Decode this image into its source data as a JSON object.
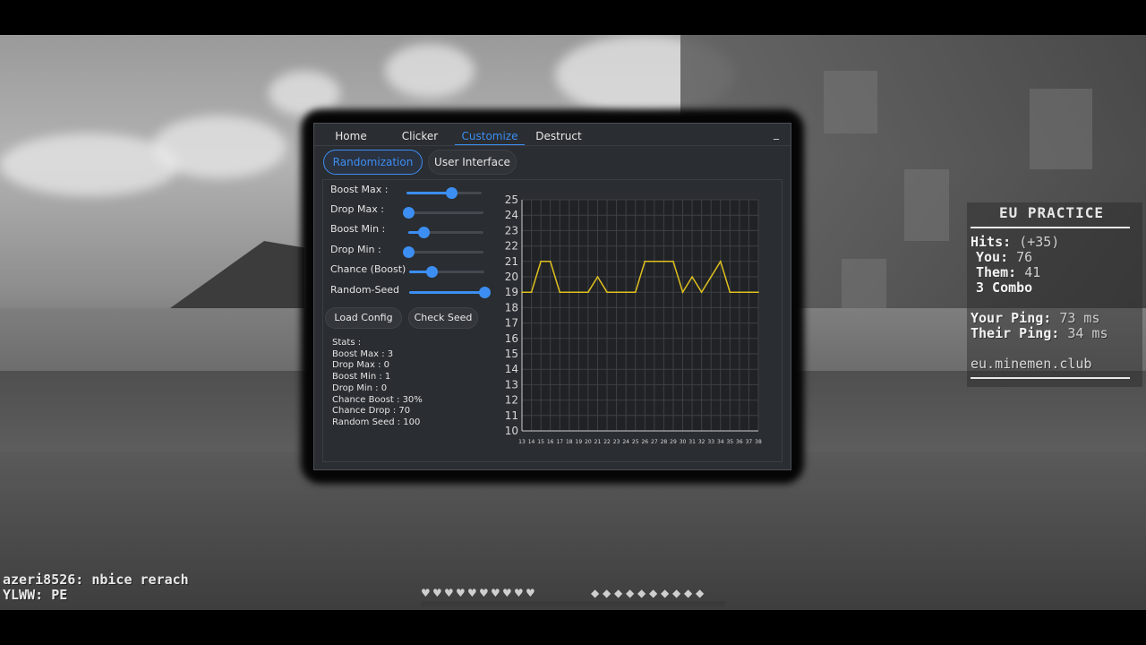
{
  "app": {
    "tabs": [
      "Home",
      "Clicker",
      "Customize",
      "Destruct"
    ],
    "active_tab": "Customize",
    "minimize": "_",
    "subtabs": [
      "Randomization",
      "User Interface"
    ],
    "active_subtab": "Randomization",
    "accent": "#3c8ef2",
    "sliders": [
      {
        "label": "Boost Max :",
        "value_fraction": 0.59
      },
      {
        "label": "Drop Max :",
        "value_fraction": 0.0
      },
      {
        "label": "Boost Min :",
        "value_fraction": 0.2
      },
      {
        "label": "Drop Min :",
        "value_fraction": 0.0
      },
      {
        "label": "Chance (Boost)",
        "value_fraction": 0.3
      },
      {
        "label": "Random-Seed",
        "value_fraction": 1.0
      }
    ],
    "buttons": {
      "load_config": "Load Config",
      "check_seed": "Check Seed"
    },
    "stats": {
      "header": "Stats :",
      "lines": [
        "Boost Max : 3",
        "Drop Max : 0",
        "Boost Min : 1",
        "Drop Min : 0",
        "Chance Boost : 30%",
        "Chance Drop : 70",
        "Random Seed : 100"
      ]
    }
  },
  "chart_data": {
    "type": "line",
    "x": [
      13,
      14,
      15,
      16,
      17,
      18,
      19,
      20,
      21,
      22,
      23,
      24,
      25,
      26,
      27,
      28,
      29,
      30,
      31,
      32,
      33,
      34,
      35,
      36,
      37,
      38
    ],
    "series": [
      {
        "values": [
          19,
          19,
          21,
          21,
          19,
          19,
          19,
          19,
          20,
          19,
          19,
          19,
          19,
          21,
          21,
          21,
          21,
          19,
          20,
          19,
          20,
          21,
          19,
          19,
          19,
          19
        ],
        "color": "#e0c020"
      }
    ],
    "ylim": [
      10,
      25
    ],
    "yticks": [
      10,
      11,
      12,
      13,
      14,
      15,
      16,
      17,
      18,
      19,
      20,
      21,
      22,
      23,
      24,
      25
    ],
    "grid": true
  },
  "hud": {
    "server_title": "EU PRACTICE",
    "hits_label": "Hits:",
    "hits_value": "(+35)",
    "you_label": "You:",
    "you_value": "76",
    "them_label": "Them:",
    "them_value": "41",
    "combo": "3 Combo",
    "your_ping_label": "Your Ping:",
    "your_ping_value": "73 ms",
    "their_ping_label": "Their Ping:",
    "their_ping_value": "34 ms",
    "server_address": "eu.minemen.club"
  },
  "chat": [
    {
      "name": "azeri8526:",
      "message": "nbice rerach"
    },
    {
      "name": "YLWW:",
      "message": "PE"
    }
  ]
}
